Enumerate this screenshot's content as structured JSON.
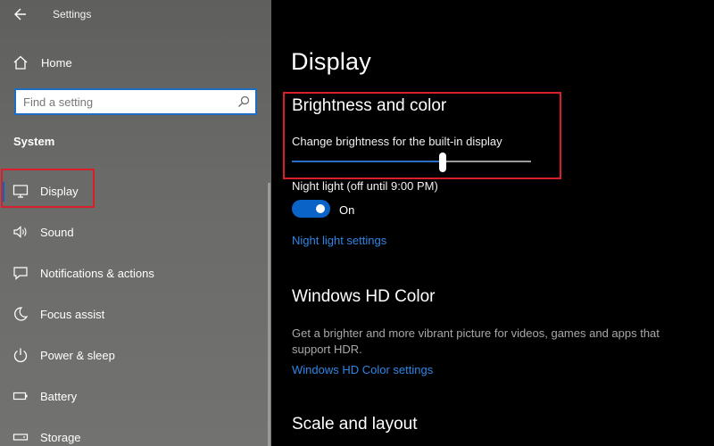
{
  "app": {
    "title": "Settings"
  },
  "sidebar": {
    "home_label": "Home",
    "search": {
      "placeholder": "Find a setting"
    },
    "section_title": "System",
    "items": [
      {
        "label": "Display",
        "icon": "monitor-icon",
        "active": true
      },
      {
        "label": "Sound",
        "icon": "speaker-icon"
      },
      {
        "label": "Notifications & actions",
        "icon": "notification-icon"
      },
      {
        "label": "Focus assist",
        "icon": "moon-icon"
      },
      {
        "label": "Power & sleep",
        "icon": "power-icon"
      },
      {
        "label": "Battery",
        "icon": "battery-icon"
      },
      {
        "label": "Storage",
        "icon": "storage-icon"
      }
    ]
  },
  "main": {
    "page_title": "Display",
    "brightness": {
      "heading": "Brightness and color",
      "label": "Change brightness for the built-in display",
      "value_percent": 63
    },
    "night_light": {
      "label": "Night light (off until 9:00 PM)",
      "state_label": "On",
      "enabled": true,
      "settings_link": "Night light settings"
    },
    "hd_color": {
      "heading": "Windows HD Color",
      "description": "Get a brighter and more vibrant picture for videos, games and apps that support HDR.",
      "settings_link": "Windows HD Color settings"
    },
    "scale": {
      "heading": "Scale and layout"
    }
  },
  "colors": {
    "accent": "#0a64c8",
    "highlight": "#d81e2a",
    "link": "#2f86e6"
  }
}
